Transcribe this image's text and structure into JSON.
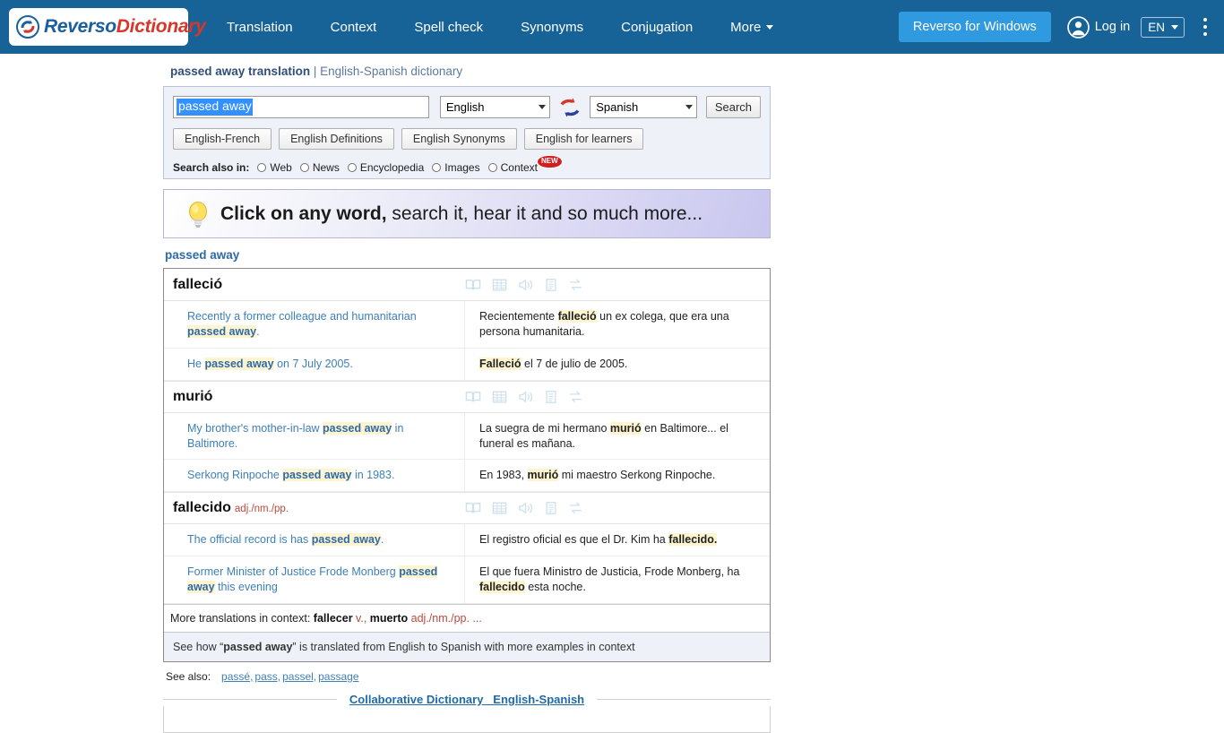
{
  "header": {
    "logo": {
      "brand_first": "Reverso",
      "brand_second": "Dictionary"
    },
    "nav": [
      {
        "label": "Translation"
      },
      {
        "label": "Context"
      },
      {
        "label": "Spell check"
      },
      {
        "label": "Synonyms"
      },
      {
        "label": "Conjugation"
      },
      {
        "label": "More",
        "has_caret": true
      }
    ],
    "windows_button": "Reverso for Windows",
    "login": "Log in",
    "language": "EN",
    "accent_blue": "#176296",
    "accent_button_blue": "#2f9ae0"
  },
  "page": {
    "title_bold": "passed away translation",
    "title_sep": " | ",
    "title_rest": "English-Spanish dictionary"
  },
  "search": {
    "query": "passed away",
    "source_lang": "English",
    "target_lang": "Spanish",
    "search_button": "Search",
    "swap_icon": "swap-languages-icon",
    "chips": [
      "English-French",
      "English Definitions",
      "English Synonyms",
      "English for learners"
    ],
    "also_label": "Search also in:",
    "also_options": [
      {
        "label": "Web",
        "badge": ""
      },
      {
        "label": "News",
        "badge": ""
      },
      {
        "label": "Encyclopedia",
        "badge": ""
      },
      {
        "label": "Images",
        "badge": ""
      },
      {
        "label": "Context",
        "badge": "NEW"
      }
    ]
  },
  "promo": {
    "icon": "lightbulb-icon",
    "bold_part": "Click on any word,",
    "rest_part": " search it,  hear it  and so much more..."
  },
  "results": {
    "heading": "passed away",
    "row_icons": [
      "open-book-icon",
      "conjugation-table-icon",
      "speaker-icon",
      "document-icon",
      "synonyms-exchange-icon"
    ],
    "entries": [
      {
        "word": "falleció",
        "pos": "",
        "examples": [
          {
            "source": [
              {
                "t": "Recently a former colleague and humanitarian ",
                "h": false
              },
              {
                "t": "passed away",
                "h": true
              },
              {
                "t": ".",
                "h": false
              }
            ],
            "target": [
              {
                "t": "Recientemente ",
                "h": false
              },
              {
                "t": "falleció",
                "h": true
              },
              {
                "t": " un ex colega, que era una persona humanitaria.",
                "h": false
              }
            ]
          },
          {
            "source": [
              {
                "t": "He ",
                "h": false
              },
              {
                "t": "passed away",
                "h": true
              },
              {
                "t": " on 7 July 2005.",
                "h": false
              }
            ],
            "target": [
              {
                "t": "Falleció",
                "h": true
              },
              {
                "t": " el 7 de julio de 2005.",
                "h": false
              }
            ]
          }
        ]
      },
      {
        "word": "murió",
        "pos": "",
        "examples": [
          {
            "source": [
              {
                "t": "My brother's mother-in-law ",
                "h": false
              },
              {
                "t": "passed away",
                "h": true
              },
              {
                "t": " in Baltimore.",
                "h": false
              }
            ],
            "target": [
              {
                "t": "La suegra de mi hermano ",
                "h": false
              },
              {
                "t": "murió",
                "h": true
              },
              {
                "t": " en Baltimore... el funeral es mañana.",
                "h": false
              }
            ]
          },
          {
            "source": [
              {
                "t": "Serkong Rinpoche ",
                "h": false
              },
              {
                "t": "passed away",
                "h": true
              },
              {
                "t": " in 1983.",
                "h": false
              }
            ],
            "target": [
              {
                "t": "En 1983, ",
                "h": false
              },
              {
                "t": "murió",
                "h": true
              },
              {
                "t": " mi maestro Serkong Rinpoche.",
                "h": false
              }
            ]
          }
        ]
      },
      {
        "word": "fallecido",
        "pos": "adj./nm./pp.",
        "examples": [
          {
            "source": [
              {
                "t": "The official record is has ",
                "h": false
              },
              {
                "t": "passed away",
                "h": true
              },
              {
                "t": ".",
                "h": false
              }
            ],
            "target": [
              {
                "t": "El registro oficial es que el Dr. Kim ha ",
                "h": false
              },
              {
                "t": "fallecido.",
                "h": true
              }
            ]
          },
          {
            "source": [
              {
                "t": "Former Minister of Justice Frode Monberg ",
                "h": false
              },
              {
                "t": "passed away",
                "h": true
              },
              {
                "t": " this evening",
                "h": false
              }
            ],
            "target": [
              {
                "t": "El que fuera Ministro de Justicia, Frode Monberg, ha ",
                "h": false
              },
              {
                "t": "fallecido",
                "h": true
              },
              {
                "t": " esta noche.",
                "h": false
              }
            ]
          }
        ]
      }
    ],
    "more_translations": {
      "prefix": "More translations in context: ",
      "items": [
        {
          "word": "fallecer",
          "pos": " v.,"
        },
        {
          "word": " muerto",
          "pos": " adj./nm./pp. ..."
        }
      ]
    },
    "context_row": {
      "before": "See how “",
      "term": "passed away",
      "after": "” is translated from English to Spanish with more examples in context"
    }
  },
  "see_also": {
    "label": "See also:",
    "links": [
      "passé,",
      "pass,",
      "passel,",
      "passage"
    ]
  },
  "collaborative": {
    "title": "Collaborative Dictionary",
    "pair": "English-Spanish"
  }
}
